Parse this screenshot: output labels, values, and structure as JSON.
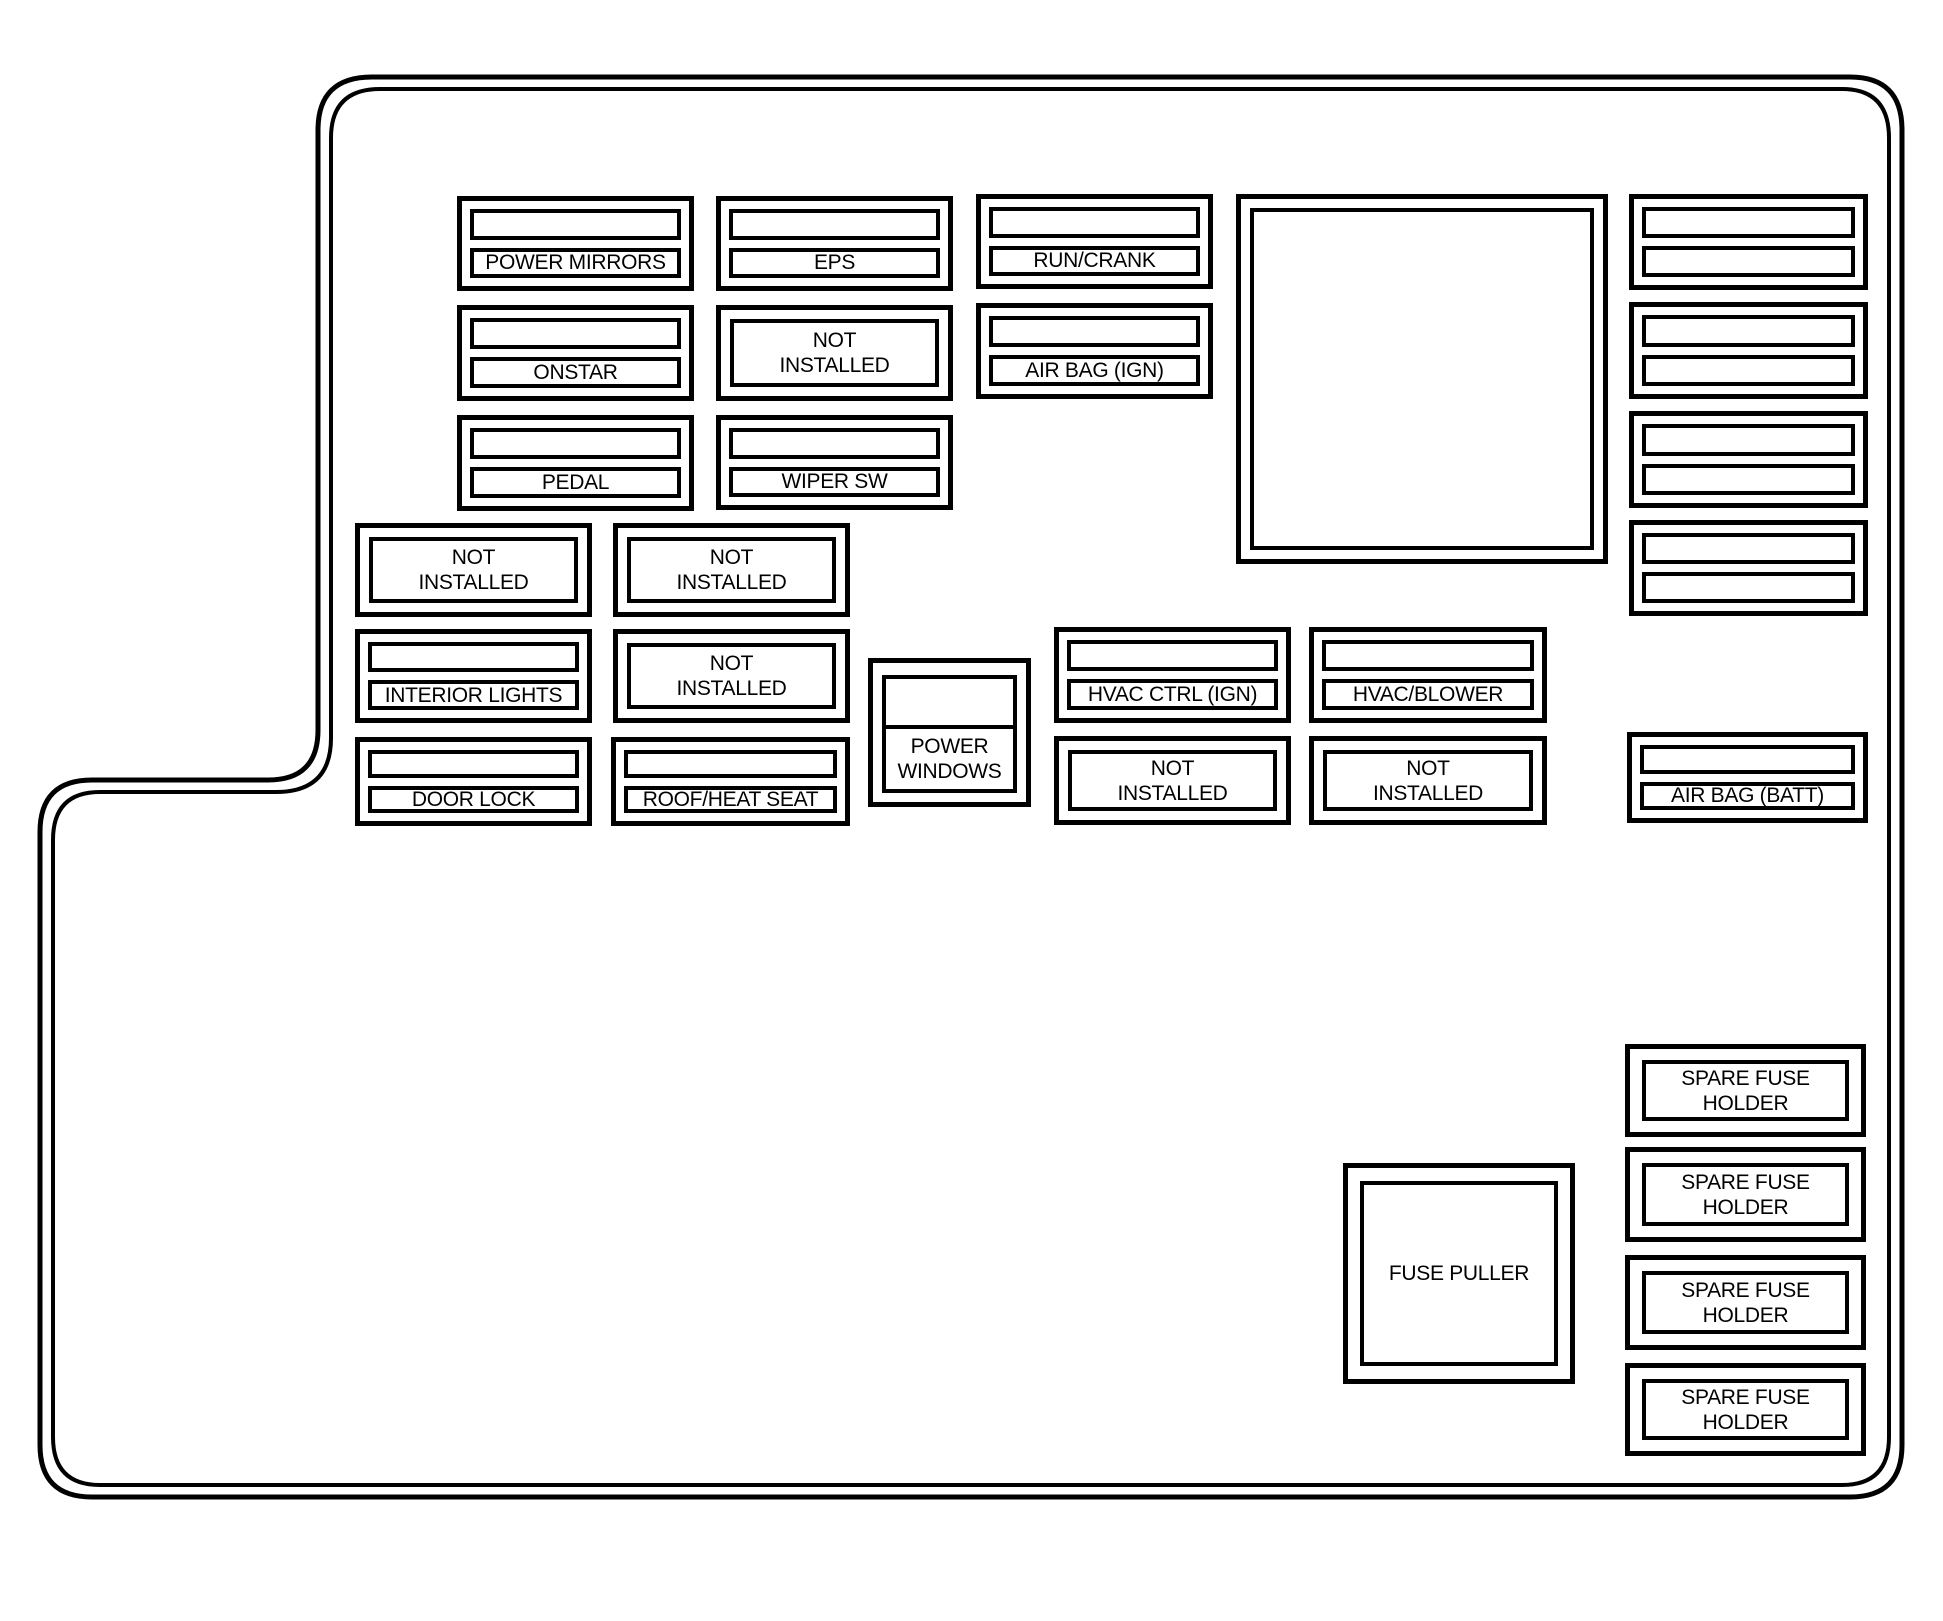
{
  "diagram": {
    "title": "",
    "type": "fuse-box-layout",
    "line_color": "#000000",
    "background": "#ffffff"
  },
  "fuses": {
    "power_mirrors": {
      "top": "",
      "label": "POWER MIRRORS"
    },
    "eps": {
      "top": "",
      "label": "EPS"
    },
    "run_crank": {
      "top": "",
      "label": "RUN/CRANK"
    },
    "onstar": {
      "top": "",
      "label": "ONSTAR"
    },
    "not_installed_1": {
      "label": "NOT\nINSTALLED"
    },
    "air_bag_ign": {
      "top": "",
      "label": "AIR BAG (IGN)"
    },
    "pedal": {
      "top": "",
      "label": "PEDAL"
    },
    "wiper_sw": {
      "top": "",
      "label": "WIPER SW"
    },
    "not_installed_2": {
      "label": "NOT\nINSTALLED"
    },
    "not_installed_3": {
      "label": "NOT\nINSTALLED"
    },
    "interior_lights": {
      "top": "",
      "label": "INTERIOR LIGHTS"
    },
    "not_installed_4": {
      "label": "NOT\nINSTALLED"
    },
    "power_windows": {
      "top": "",
      "label": "POWER\nWINDOWS"
    },
    "hvac_ctrl_ign": {
      "top": "",
      "label": "HVAC CTRL (IGN)"
    },
    "hvac_blower": {
      "top": "",
      "label": "HVAC/BLOWER"
    },
    "door_lock": {
      "top": "",
      "label": "DOOR LOCK"
    },
    "roof_heat_seat": {
      "top": "",
      "label": "ROOF/HEAT SEAT"
    },
    "not_installed_5": {
      "label": "NOT\nINSTALLED"
    },
    "not_installed_6": {
      "label": "NOT\nINSTALLED"
    },
    "air_bag_batt": {
      "top": "",
      "label": "AIR BAG (BATT)"
    },
    "right_1": {
      "top": "",
      "label": ""
    },
    "right_2": {
      "top": "",
      "label": ""
    },
    "right_3": {
      "top": "",
      "label": ""
    },
    "right_4": {
      "top": "",
      "label": ""
    }
  },
  "relay": {
    "label": ""
  },
  "fuse_puller": {
    "label": "FUSE PULLER"
  },
  "spare_holders": [
    {
      "label": "SPARE FUSE\nHOLDER"
    },
    {
      "label": "SPARE FUSE\nHOLDER"
    },
    {
      "label": "SPARE FUSE\nHOLDER"
    },
    {
      "label": "SPARE FUSE\nHOLDER"
    }
  ]
}
